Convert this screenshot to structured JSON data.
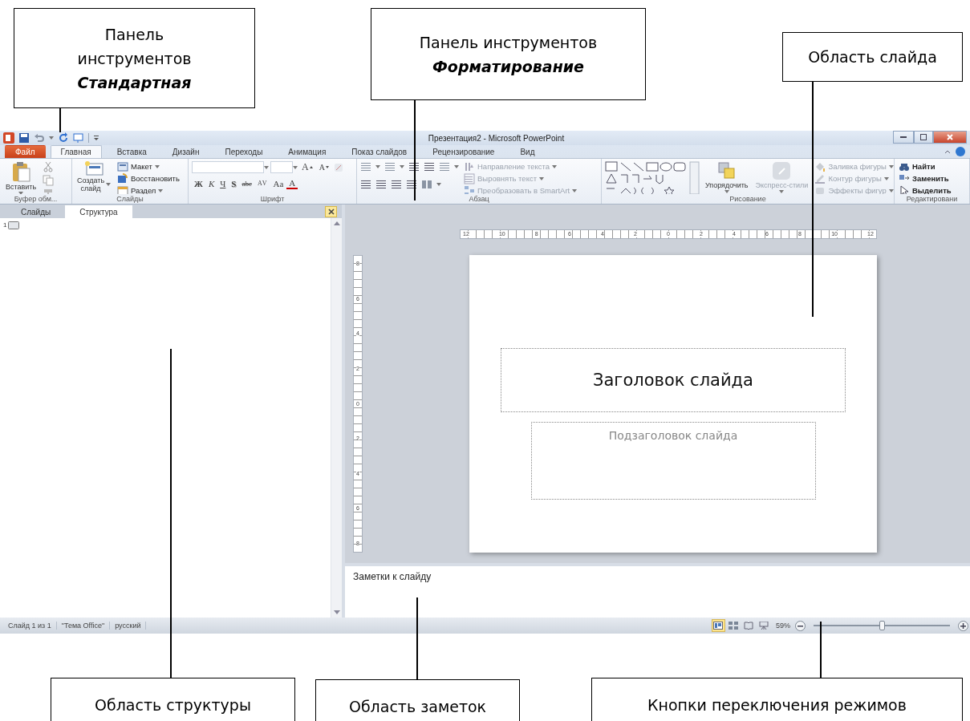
{
  "callouts": [
    {
      "text": "Панель инструментов",
      "emphasis": "Стандартная"
    },
    {
      "text": "Панель инструментов",
      "emphasis": "Форматирование"
    },
    {
      "text": "Область слайда"
    },
    {
      "text": "Область структуры"
    },
    {
      "text": "Область заметок"
    },
    {
      "text": "Кнопки переключения режимов"
    }
  ],
  "window": {
    "title": "Презентация2 - Microsoft PowerPoint"
  },
  "ribbon_tabs": [
    {
      "label": "Файл",
      "kind": "file",
      "selected": false
    },
    {
      "label": "Главная",
      "kind": "tab",
      "selected": true
    },
    {
      "label": "Вставка",
      "kind": "tab",
      "selected": false
    },
    {
      "label": "Дизайн",
      "kind": "tab",
      "selected": false
    },
    {
      "label": "Переходы",
      "kind": "tab",
      "selected": false
    },
    {
      "label": "Анимация",
      "kind": "tab",
      "selected": false
    },
    {
      "label": "Показ слайдов",
      "kind": "tab",
      "selected": false
    },
    {
      "label": "Рецензирование",
      "kind": "tab",
      "selected": false
    },
    {
      "label": "Вид",
      "kind": "tab",
      "selected": false
    }
  ],
  "clipboard": {
    "label": "Буфер обм...",
    "paste": "Вставить"
  },
  "slides_group": {
    "label": "Слайды",
    "new_slide": "Создать слайд",
    "items": [
      "Макет",
      "Восстановить",
      "Раздел"
    ]
  },
  "font": {
    "label": "Шрифт",
    "size_buttons": [
      {
        "label": "A",
        "kind": "grow"
      },
      {
        "label": "A",
        "kind": "shrink"
      }
    ],
    "format_buttons": [
      {
        "label": "Ж",
        "kind": "bold"
      },
      {
        "label": "К",
        "kind": "italic"
      },
      {
        "label": "Ч",
        "kind": "underline"
      },
      {
        "label": "S",
        "kind": "shadow"
      },
      {
        "label": "abe",
        "kind": "strike"
      },
      {
        "label": "AV",
        "kind": "spacing"
      },
      {
        "label": "Aa",
        "kind": "case"
      },
      {
        "label": "A",
        "kind": "color"
      }
    ]
  },
  "paragraph": {
    "label": "Абзац",
    "items": [
      {
        "label": "Направление текста",
        "disabled": true
      },
      {
        "label": "Выровнять текст",
        "disabled": true
      },
      {
        "label": "Преобразовать в SmartArt",
        "disabled": true
      }
    ]
  },
  "drawing": {
    "label": "Рисование",
    "arrange": "Упорядочить",
    "styles": {
      "label": "Экспресс-стили",
      "disabled": true
    },
    "items": [
      {
        "label": "Заливка фигуры",
        "disabled": true
      },
      {
        "label": "Контур фигуры",
        "disabled": true
      },
      {
        "label": "Эффекты фигур",
        "disabled": true
      }
    ]
  },
  "editing": {
    "label": "Редактировани",
    "items": [
      {
        "label": "Найти",
        "disabled": false
      },
      {
        "label": "Заменить",
        "disabled": false
      },
      {
        "label": "Выделить",
        "disabled": false
      }
    ]
  },
  "outline_pane": {
    "tabs": [
      {
        "label": "Слайды",
        "selected": false
      },
      {
        "label": "Структура",
        "selected": true
      }
    ],
    "slide_number": "1"
  },
  "rulers": {
    "horizontal": [
      "12",
      "10",
      "8",
      "6",
      "4",
      "2",
      "0",
      "2",
      "4",
      "6",
      "8",
      "10",
      "12"
    ],
    "vertical": [
      "8",
      "6",
      "4",
      "2",
      "0",
      "2",
      "4",
      "6",
      "8"
    ]
  },
  "slide": {
    "title": "Заголовок слайда",
    "subtitle": "Подзаголовок слайда"
  },
  "notes": {
    "placeholder": "Заметки к слайду"
  },
  "status_bar": {
    "items": [
      "Слайд 1 из 1",
      "\"Тема Office\"",
      "русский"
    ],
    "views": [
      {
        "kind": "normal",
        "selected": true
      },
      {
        "kind": "sorter",
        "selected": false
      },
      {
        "kind": "reading",
        "selected": false
      },
      {
        "kind": "show",
        "selected": false
      }
    ],
    "zoom": "59%",
    "zoom_level": {
      "level": 0.5
    }
  }
}
